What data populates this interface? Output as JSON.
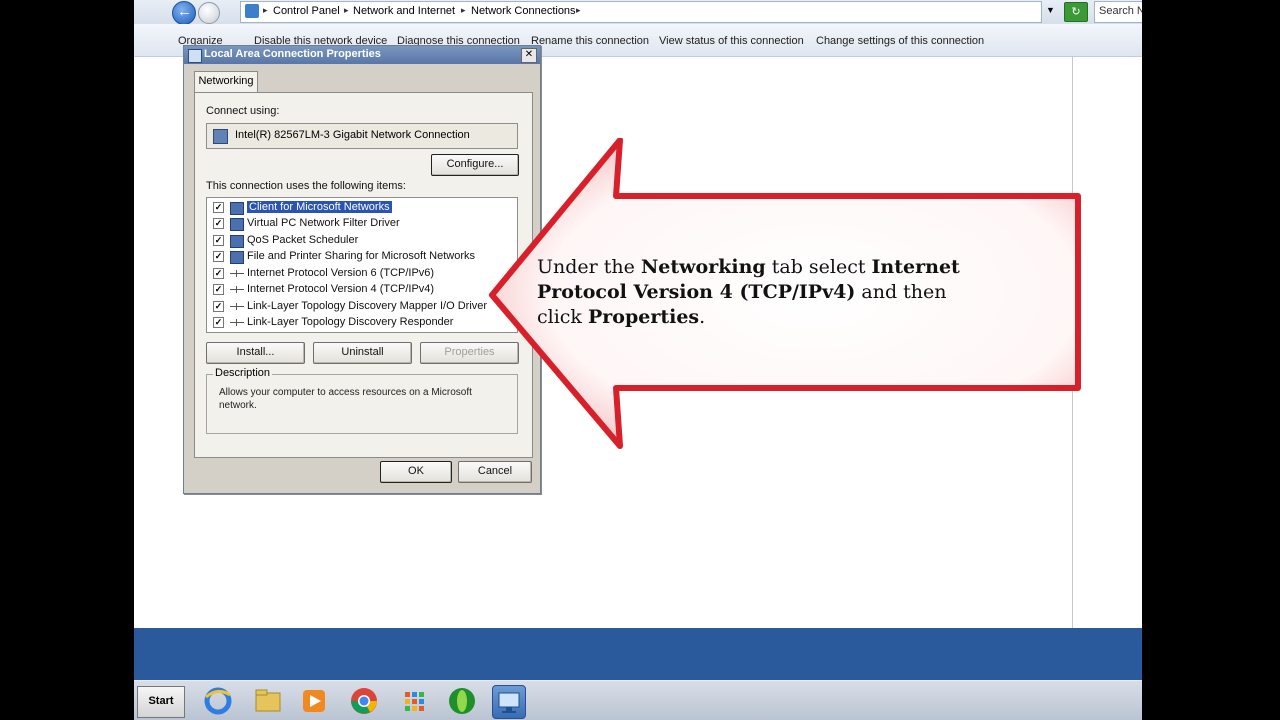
{
  "address_bar": {
    "crumbs": [
      "Control Panel",
      "Network and Internet",
      "Network Connections"
    ],
    "search_placeholder": "Search N"
  },
  "toolbar": {
    "organize": "Organize",
    "disable": "Disable this network device",
    "diagnose": "Diagnose this connection",
    "rename": "Rename this connection",
    "view_status": "View status of this connection",
    "change_settings": "Change settings of this connection"
  },
  "dialog": {
    "title": "Local Area Connection Properties",
    "tab": "Networking",
    "connect_using_label": "Connect using:",
    "adapter": "Intel(R) 82567LM-3 Gigabit Network Connection",
    "configure_button": "Configure...",
    "items_label": "This connection uses the following items:",
    "items": [
      {
        "label": "Client for Microsoft Networks",
        "checked": true,
        "selected": true,
        "icon": "network-client-icon"
      },
      {
        "label": "Virtual PC Network Filter Driver",
        "checked": true,
        "selected": false,
        "icon": "network-service-icon"
      },
      {
        "label": "QoS Packet Scheduler",
        "checked": true,
        "selected": false,
        "icon": "network-service-icon"
      },
      {
        "label": "File and Printer Sharing for Microsoft Networks",
        "checked": true,
        "selected": false,
        "icon": "network-service-icon"
      },
      {
        "label": "Internet Protocol Version 6 (TCP/IPv6)",
        "checked": true,
        "selected": false,
        "icon": "protocol-icon"
      },
      {
        "label": "Internet Protocol Version 4 (TCP/IPv4)",
        "checked": true,
        "selected": false,
        "icon": "protocol-icon"
      },
      {
        "label": "Link-Layer Topology Discovery Mapper I/O Driver",
        "checked": true,
        "selected": false,
        "icon": "protocol-icon"
      },
      {
        "label": "Link-Layer Topology Discovery Responder",
        "checked": true,
        "selected": false,
        "icon": "protocol-icon"
      }
    ],
    "install_button": "Install...",
    "uninstall_button": "Uninstall",
    "properties_button": "Properties",
    "description_title": "Description",
    "description_text": "Allows your computer to access resources on a Microsoft network.",
    "ok_button": "OK",
    "cancel_button": "Cancel"
  },
  "callout": {
    "t1": "Under the ",
    "b1": "Networking",
    "t2": " tab select ",
    "b2": "Internet Protocol Version 4 (TCP/IPv4)",
    "t3": " and then click ",
    "b3": "Properties",
    "t4": ".",
    "arrow_color": "#d8202a"
  },
  "taskbar": {
    "start_label": "Start",
    "apps": [
      "internet-explorer-icon",
      "file-explorer-icon",
      "media-player-icon",
      "chrome-icon",
      "apps-grid-icon",
      "green-orb-icon",
      "network-connections-icon"
    ]
  }
}
